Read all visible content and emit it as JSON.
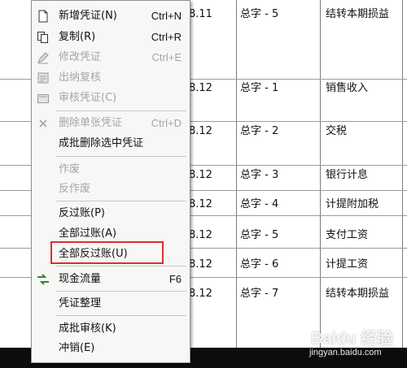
{
  "menu": {
    "items": [
      {
        "label": "新增凭证(N)",
        "shortcut": "Ctrl+N",
        "enabled": true,
        "icon": "new-voucher-icon"
      },
      {
        "label": "复制(R)",
        "shortcut": "Ctrl+R",
        "enabled": true,
        "icon": "copy-icon"
      },
      {
        "label": "修改凭证",
        "shortcut": "Ctrl+E",
        "enabled": false,
        "icon": "edit-voucher-icon"
      },
      {
        "label": "出纳复核",
        "shortcut": "",
        "enabled": false,
        "icon": "cashier-review-icon"
      },
      {
        "label": "审核凭证(C)",
        "shortcut": "",
        "enabled": false,
        "icon": "audit-voucher-icon"
      },
      {
        "label": "删除单张凭证",
        "shortcut": "Ctrl+D",
        "enabled": false,
        "icon": "delete-icon"
      },
      {
        "label": "成批删除选中凭证",
        "shortcut": "",
        "enabled": true
      },
      {
        "label": "作废",
        "shortcut": "",
        "enabled": false
      },
      {
        "label": "反作废",
        "shortcut": "",
        "enabled": false
      },
      {
        "label": "反过账(P)",
        "shortcut": "",
        "enabled": true
      },
      {
        "label": "全部过账(A)",
        "shortcut": "",
        "enabled": true
      },
      {
        "label": "全部反过账(U)",
        "shortcut": "",
        "enabled": true
      },
      {
        "label": "现金流量",
        "shortcut": "F6",
        "enabled": true,
        "icon": "cash-flow-icon"
      },
      {
        "label": "凭证整理",
        "shortcut": "",
        "enabled": true
      },
      {
        "label": "成批审核(K)",
        "shortcut": "",
        "enabled": true
      },
      {
        "label": "冲销(E)",
        "shortcut": "",
        "enabled": true
      }
    ]
  },
  "table": {
    "rows": [
      {
        "date": "8.11",
        "voucher": "总字 - 5",
        "summary": "结转本期损益"
      },
      {
        "date": "8.12",
        "voucher": "总字 - 1",
        "summary": "销售收入"
      },
      {
        "date": "8.12",
        "voucher": "总字 - 2",
        "summary": "交税"
      },
      {
        "date": "8.12",
        "voucher": "总字 - 3",
        "summary": "银行计息"
      },
      {
        "date": "8.12",
        "voucher": "总字 - 4",
        "summary": "计提附加税"
      },
      {
        "date": "8.12",
        "voucher": "总字 - 5",
        "summary": "支付工资"
      },
      {
        "date": "8.12",
        "voucher": "总字 - 6",
        "summary": "计提工资"
      },
      {
        "date": "8.12",
        "voucher": "总字 - 7",
        "summary": "结转本期损益"
      }
    ]
  },
  "watermark": {
    "brand": "Baidu 经验",
    "url": "jingyan.baidu.com"
  },
  "colors": {
    "highlight": "#d9302e",
    "disabled_text": "#a5a5a5",
    "cash_flow_icon": "#2e8b2e"
  }
}
